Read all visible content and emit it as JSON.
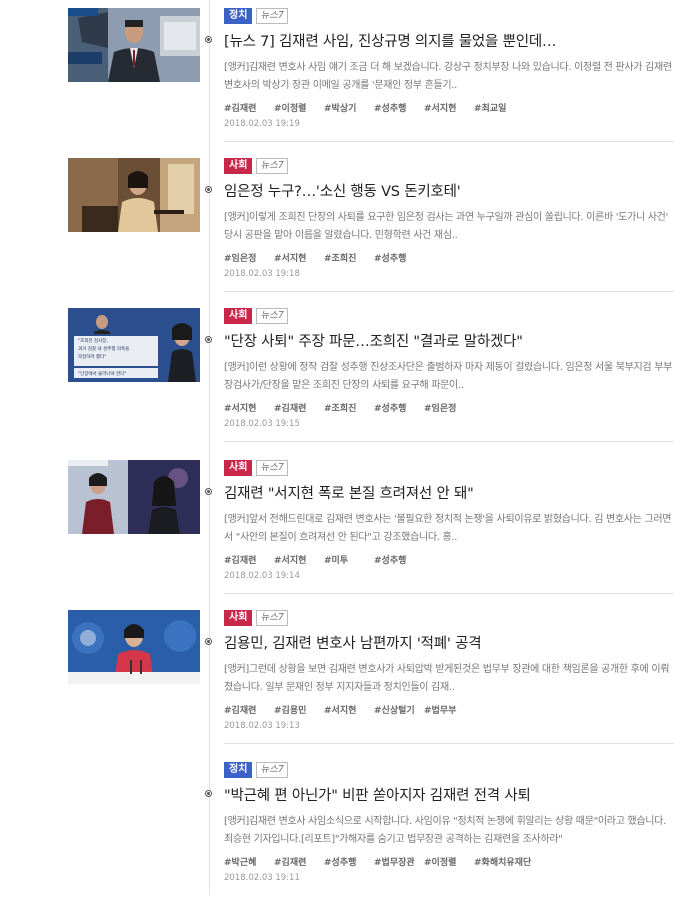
{
  "colors": {
    "politics_badge": "#3b63c6",
    "society_badge": "#c8294a"
  },
  "articles": [
    {
      "category": "정치",
      "category_color": "#3b63c6",
      "source": "뉴스7",
      "title": "[뉴스 7] 김재련 사임, 진상규명 의지를 물었을 뿐인데…",
      "summary": "[앵커]김재련 변호사 사임 얘기 조금 더 해 보겠습니다. 강상구 정치부장 나와 있습니다. 이정렬 전 판사가 김재련 변호사의 박상기 장관 이메일 공개를 '문재인 정부 흔들기..",
      "tags": [
        "#김재련",
        "#이정렬",
        "#박상기",
        "#성추행",
        "#서지현",
        "#최교일"
      ],
      "date": "2018.02.03 19:19",
      "thumb_icon": "news-anchor-thumbnail"
    },
    {
      "category": "사회",
      "category_color": "#c8294a",
      "source": "뉴스7",
      "title": "임은정 누구?…'소신 행동 VS 돈키호테'",
      "summary": "[앵커]이렇게 조희진 단장의 사퇴를 요구한 임은정 검사는 과연 누구일까 관심이 쏠립니다. 이른바 '도가니 사건' 당시 공판을 맡아 이름을 알렸습니다. 민형학련 사건 재심..",
      "tags": [
        "#임은정",
        "#서지현",
        "#조희진",
        "#성추행"
      ],
      "date": "2018.02.03 19:18",
      "thumb_icon": "lecture-photo-thumbnail"
    },
    {
      "category": "사회",
      "category_color": "#c8294a",
      "source": "뉴스7",
      "title": "\"단장 사퇴\" 주장 파문…조희진 \"결과로 말하겠다\"",
      "summary": "[앵커]이런 상황에 정작 검찰 성추행 진상조사단은 출범하자 마자 제동이 걸렸습니다. 임은정 서울 북부지검 부부장검사가/단장을 맡은 조희진 단장의 사퇴를 요구해 파문이..",
      "tags": [
        "#서지현",
        "#김재련",
        "#조희진",
        "#성추행",
        "#임은정"
      ],
      "date": "2018.02.03 19:15",
      "thumb_icon": "news-graphic-thumbnail",
      "thumb_text": [
        "\"조희진 검사장,",
        "과거 검찰 내 성추행 의혹을",
        "묵살하려 했다\"",
        "\"단장에서 물러나야 한다\""
      ]
    },
    {
      "category": "사회",
      "category_color": "#c8294a",
      "source": "뉴스7",
      "title": "김재련 \"서지현 폭로 본질 흐려져선 안 돼\"",
      "summary": "[앵커]앞서 전해드린대로 김재련 변호사는 '불필요한 정치적 논쟁'을 사퇴이유로 밝혔습니다. 김 변호사는 그러면서 \"사안의 본질이 흐려져선 안 된다\"고 강조했습니다. 홍..",
      "tags": [
        "#김재련",
        "#서지현",
        "#미투",
        "#성추행"
      ],
      "date": "2018.02.03 19:14",
      "thumb_icon": "studio-interview-thumbnail"
    },
    {
      "category": "사회",
      "category_color": "#c8294a",
      "source": "뉴스7",
      "title": "김용민, 김재련 변호사 남편까지 '적폐' 공격",
      "summary": "[앵커]그런데 상황을 보면 김재련 변호사가 사퇴압박 받게된것은 법무부 장관에 대한 책임론을 공개한 후에 이뤄졌습니다. 일부 문재인 정부 지지자들과 정치인들이 김재..",
      "tags": [
        "#김재련",
        "#김용민",
        "#서지현",
        "#신상털기",
        "#법무부"
      ],
      "date": "2018.02.03 19:13",
      "thumb_icon": "press-briefing-thumbnail"
    },
    {
      "category": "정치",
      "category_color": "#3b63c6",
      "source": "뉴스7",
      "title": "\"박근혜 편 아닌가\" 비판 쏟아지자 김재련 전격 사퇴",
      "summary": "[앵커]김재련 변호사 사임소식으로 시작합니다. 사임이유 \"정치적 논쟁에 휘말리는 상황 때문\"이라고 했습니다. 최승현 기자입니다.[리포트]\"가해자를 숨기고 법무장관 공격하는 김재련을 조사하라\"",
      "tags": [
        "#박근혜",
        "#김재련",
        "#성추행",
        "#법무장관",
        "#이정렬",
        "#화해치유재단"
      ],
      "date": "2018.02.03 19:11",
      "thumb_icon": "none"
    }
  ]
}
